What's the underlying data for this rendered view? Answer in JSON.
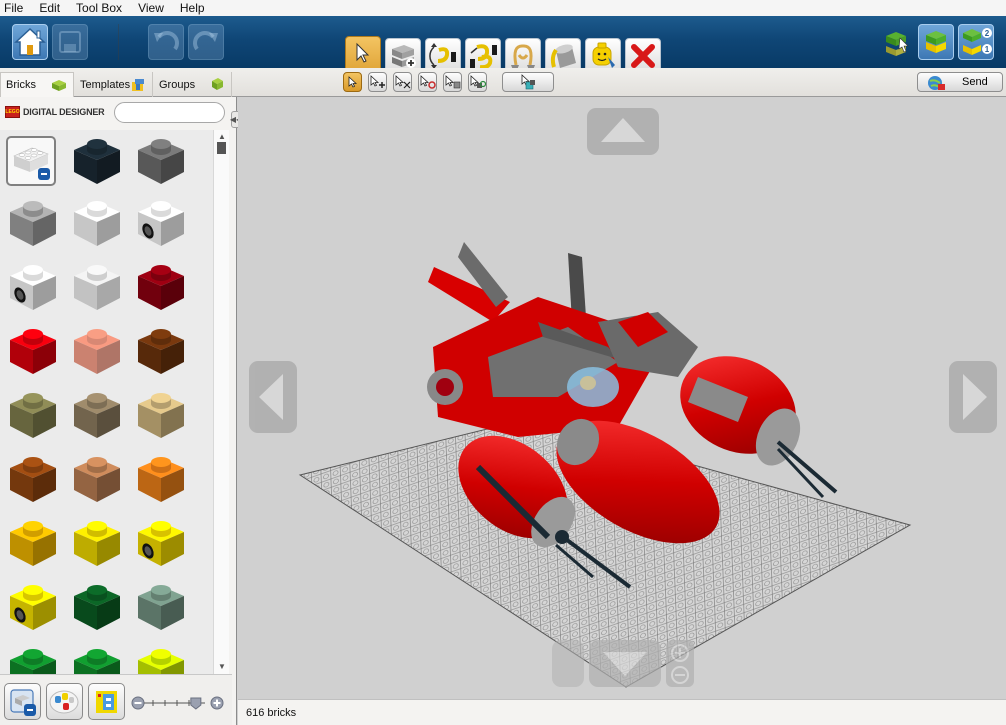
{
  "app": {
    "name": "LEGO Digital Designer",
    "brand_text": "DIGITAL DESIGNER",
    "logo_text": "LEGO"
  },
  "menu": [
    "File",
    "Edit",
    "Tool Box",
    "View",
    "Help"
  ],
  "toolbar": {
    "left_buttons": [
      {
        "name": "home",
        "label": "Home",
        "enabled": true
      },
      {
        "name": "save",
        "label": "Save",
        "enabled": false
      },
      {
        "name": "undo",
        "label": "Undo",
        "enabled": false
      },
      {
        "name": "redo",
        "label": "Redo",
        "enabled": false
      }
    ],
    "tools": [
      {
        "name": "select-tool",
        "label": "Select",
        "active": true
      },
      {
        "name": "clone-tool",
        "label": "Clone",
        "active": false
      },
      {
        "name": "hinge-tool",
        "label": "Hinge",
        "active": false
      },
      {
        "name": "hinge-align-tool",
        "label": "Hinge Align",
        "active": false
      },
      {
        "name": "flex-tool",
        "label": "Flex",
        "active": false
      },
      {
        "name": "paint-bucket-tool",
        "label": "Paint Bucket",
        "active": false
      },
      {
        "name": "decoration-tool",
        "label": "Decoration",
        "active": false
      },
      {
        "name": "delete-tool",
        "label": "Delete",
        "active": false
      }
    ],
    "mode_buttons": [
      {
        "name": "build-mode",
        "label": "Build Mode"
      },
      {
        "name": "view-mode",
        "label": "View Mode"
      },
      {
        "name": "building-guide-mode",
        "label": "Building Guide Mode",
        "badges": [
          "2",
          "1"
        ]
      }
    ]
  },
  "subtoolbar": {
    "tabs": [
      {
        "label": "Bricks",
        "active": true
      },
      {
        "label": "Templates",
        "active": false
      },
      {
        "label": "Groups",
        "active": false
      }
    ],
    "select_modes": [
      {
        "name": "single-select",
        "active": true
      },
      {
        "name": "multi-select-add",
        "active": false
      },
      {
        "name": "invert-select",
        "active": false
      },
      {
        "name": "select-connected",
        "active": false
      },
      {
        "name": "select-same-color",
        "active": false
      },
      {
        "name": "select-same-brick",
        "active": false
      }
    ],
    "group_select": {
      "name": "select-group"
    },
    "send_label": "Send"
  },
  "palette": {
    "search_placeholder": "",
    "bricks": [
      {
        "color": "#e8e8e8",
        "kind": "category-brick",
        "selected": true
      },
      {
        "color": "#1b2a34",
        "kind": "1x1"
      },
      {
        "color": "#6b6b6b",
        "kind": "1x1"
      },
      {
        "color": "#9c9c9c",
        "kind": "1x1"
      },
      {
        "color": "#f2f2f2",
        "kind": "1x1"
      },
      {
        "color": "#f2f2f2",
        "kind": "1x1-printed"
      },
      {
        "color": "#f2f2f2",
        "kind": "1x1-printed"
      },
      {
        "color": "#d8d8d8",
        "kind": "1x1-transparent"
      },
      {
        "color": "#8a0010",
        "kind": "1x1"
      },
      {
        "color": "#d8000c",
        "kind": "1x1"
      },
      {
        "color": "#e8694a",
        "kind": "1x1-transparent"
      },
      {
        "color": "#6a320c",
        "kind": "1x1"
      },
      {
        "color": "#7d7b4c",
        "kind": "1x1"
      },
      {
        "color": "#8b7a5e",
        "kind": "1x1"
      },
      {
        "color": "#c8b07a",
        "kind": "1x1"
      },
      {
        "color": "#8e4410",
        "kind": "1x1"
      },
      {
        "color": "#b47a50",
        "kind": "1x1"
      },
      {
        "color": "#e57c18",
        "kind": "1x1"
      },
      {
        "color": "#e8b000",
        "kind": "1x1"
      },
      {
        "color": "#e8d200",
        "kind": "1x1"
      },
      {
        "color": "#f0d800",
        "kind": "1x1-printed"
      },
      {
        "color": "#f0dc00",
        "kind": "1x1-printed"
      },
      {
        "color": "#0a5a22",
        "kind": "1x1"
      },
      {
        "color": "#6f8e7e",
        "kind": "1x1"
      },
      {
        "color": "#0f8a2a",
        "kind": "1x1"
      },
      {
        "color": "#0f8a2a",
        "kind": "1x1"
      },
      {
        "color": "#c8e800",
        "kind": "1x1"
      }
    ],
    "zoom_level": 0.85,
    "bottom_buttons": [
      {
        "name": "brick-view-toggle",
        "label": "Collapse brick palette"
      },
      {
        "name": "color-palette",
        "label": "Color palette"
      },
      {
        "name": "brick-filter",
        "label": "Brick filter"
      }
    ]
  },
  "viewport": {
    "model": "Red spaceship model",
    "nav": [
      "up",
      "down",
      "left",
      "right",
      "zoom-in",
      "zoom-out"
    ]
  },
  "status": {
    "brick_count": "616 bricks"
  }
}
